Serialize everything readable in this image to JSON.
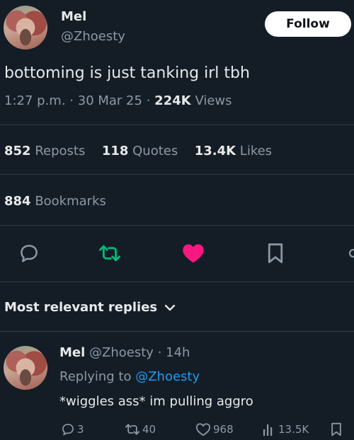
{
  "tweet": {
    "author_name": "Mel",
    "author_handle": "@Zhoesty",
    "follow_label": "Follow",
    "text": "bottoming is just tanking irl tbh",
    "time": "1:27 p.m.",
    "dot": "·",
    "date": "30 Mar 25",
    "views_count": "224K",
    "views_label": "Views"
  },
  "stats": {
    "reposts_count": "852",
    "reposts_label": "Reposts",
    "quotes_count": "118",
    "quotes_label": "Quotes",
    "likes_count": "13.4K",
    "likes_label": "Likes",
    "bookmarks_count": "884",
    "bookmarks_label": "Bookmarks"
  },
  "actions": {
    "reply_icon": "reply-icon",
    "repost_icon": "repost-icon",
    "like_icon": "heart-icon",
    "bookmark_icon": "bookmark-icon",
    "repost_color": "#00ba7c",
    "like_color": "#f91880"
  },
  "replies_header": {
    "label": "Most relevant replies"
  },
  "reply": {
    "author_name": "Mel",
    "author_handle": "@Zhoesty",
    "dot": "·",
    "age": "14h",
    "replying_prefix": "Replying to",
    "replying_to": "@Zhoesty",
    "text": "*wiggles ass* im pulling aggro",
    "replies_count": "3",
    "reposts_count": "40",
    "likes_count": "968",
    "views_count": "13.5K"
  },
  "colors": {
    "background": "#141d26",
    "link": "#1d9bf0"
  }
}
